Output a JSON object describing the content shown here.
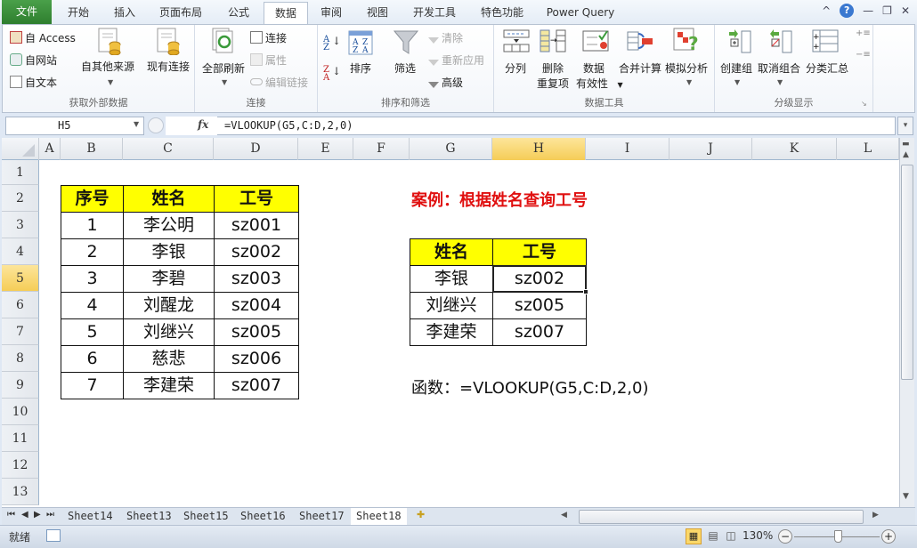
{
  "ribbon_tabs": [
    {
      "label": "文件",
      "state": "file"
    },
    {
      "label": "开始"
    },
    {
      "label": "插入"
    },
    {
      "label": "页面布局"
    },
    {
      "label": "公式"
    },
    {
      "label": "数据",
      "state": "active"
    },
    {
      "label": "审阅"
    },
    {
      "label": "视图"
    },
    {
      "label": "开发工具"
    },
    {
      "label": "特色功能"
    },
    {
      "label": "Power Query"
    }
  ],
  "window_controls": {
    "help": "?",
    "minimize_ribbon": "^",
    "minimize": "—",
    "restore": "❐",
    "close": "✕"
  },
  "ribbon": {
    "groups": {
      "get_external": {
        "label": "获取外部数据",
        "from_access": "自 Access",
        "from_web": "自网站",
        "from_text": "自文本",
        "from_other": "自其他来源",
        "existing": "现有连接"
      },
      "connections": {
        "label": "连接",
        "refresh_all": "全部刷新",
        "connections": "连接",
        "properties": "属性",
        "edit_links": "编辑链接"
      },
      "sort_filter": {
        "label": "排序和筛选",
        "sort_az": "A→Z",
        "sort_za": "Z→A",
        "sort": "排序",
        "filter": "筛选",
        "clear": "清除",
        "reapply": "重新应用",
        "advanced": "高级"
      },
      "data_tools": {
        "label": "数据工具",
        "text_to_columns": "分列",
        "remove_dup_1": "删除",
        "remove_dup_2": "重复项",
        "validation_1": "数据",
        "validation_2": "有效性",
        "consolidate": "合并计算",
        "what_if": "模拟分析"
      },
      "outline": {
        "label": "分级显示",
        "group": "创建组",
        "ungroup": "取消组合",
        "subtotal": "分类汇总"
      }
    }
  },
  "formula_bar": {
    "name_box": "H5",
    "fx": "fx",
    "formula": "=VLOOKUP(G5,C:D,2,0)"
  },
  "columns": [
    "A",
    "B",
    "C",
    "D",
    "E",
    "F",
    "G",
    "H",
    "I",
    "J",
    "K",
    "L"
  ],
  "selected_column": "H",
  "rows": [
    "1",
    "2",
    "3",
    "4",
    "5",
    "6",
    "7",
    "8",
    "9",
    "10",
    "11",
    "12",
    "13"
  ],
  "selected_row": "5",
  "source_table": {
    "headers": [
      "序号",
      "姓名",
      "工号"
    ],
    "rows": [
      [
        "1",
        "李公明",
        "sz001"
      ],
      [
        "2",
        "李银",
        "sz002"
      ],
      [
        "3",
        "李碧",
        "sz003"
      ],
      [
        "4",
        "刘醒龙",
        "sz004"
      ],
      [
        "5",
        "刘继兴",
        "sz005"
      ],
      [
        "6",
        "慈悲",
        "sz006"
      ],
      [
        "7",
        "李建荣",
        "sz007"
      ]
    ]
  },
  "case_title": "案例：根据姓名查询工号",
  "lookup_table": {
    "headers": [
      "姓名",
      "工号"
    ],
    "rows": [
      [
        "李银",
        "sz002"
      ],
      [
        "刘继兴",
        "sz005"
      ],
      [
        "李建荣",
        "sz007"
      ]
    ]
  },
  "function_note": "函数：=VLOOKUP(G5,C:D,2,0)",
  "sheet_tabs": [
    {
      "label": "Sheet14"
    },
    {
      "label": "Sheet13"
    },
    {
      "label": "Sheet15"
    },
    {
      "label": "Sheet16"
    },
    {
      "label": "Sheet17"
    },
    {
      "label": "Sheet18",
      "active": true
    }
  ],
  "status": {
    "ready": "就绪",
    "zoom": "130%",
    "zoom_minus": "−",
    "zoom_plus": "+"
  },
  "colors": {
    "header_fill": "#ffff00",
    "title_red": "#e01010",
    "file_tab_green": "#2d7d2d",
    "selection_highlight": "#f5cd57"
  }
}
